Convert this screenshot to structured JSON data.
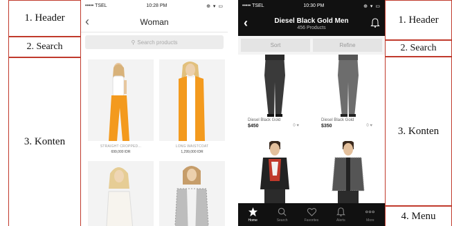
{
  "labels_left": [
    "1. Header",
    "2. Search",
    "3. Konten"
  ],
  "labels_right": [
    "1. Header",
    "2. Search",
    "3. Konten",
    "4. Menu"
  ],
  "phone1": {
    "status": {
      "carrier": "••••• TSEL",
      "time": "10:28 PM",
      "icons": "⊕ ▾ ▭"
    },
    "title": "Woman",
    "search_placeholder": "Search products",
    "products": [
      {
        "name": "STRAIGHT CROPPED...",
        "price": "699,000 IDR"
      },
      {
        "name": "LONG WAISTCOAT",
        "price": "1,299,000 IDR"
      },
      {
        "name": "",
        "price": ""
      },
      {
        "name": "",
        "price": ""
      }
    ]
  },
  "phone2": {
    "status": {
      "carrier": "••••• TSEL",
      "time": "10:30 PM",
      "icons": "⊕ ▾ ▭"
    },
    "title": "Diesel Black Gold Men",
    "subtitle": "456 Products",
    "sort_label": "Sort",
    "refine_label": "Refine",
    "products": [
      {
        "name": "Diesel Black Gold",
        "price": "$450",
        "wish": "0 ♥"
      },
      {
        "name": "Diesel Black Gold",
        "price": "$350",
        "wish": "0 ♥"
      },
      {
        "name": "",
        "price": "",
        "wish": ""
      },
      {
        "name": "",
        "price": "",
        "wish": ""
      }
    ],
    "tabs": [
      {
        "label": "Home",
        "icon": "star-icon"
      },
      {
        "label": "Search",
        "icon": "search-icon"
      },
      {
        "label": "Favorites",
        "icon": "heart-icon"
      },
      {
        "label": "Alerts",
        "icon": "bell-icon"
      },
      {
        "label": "More",
        "icon": "more-icon"
      }
    ]
  },
  "colors": {
    "annotation_border": "#c0392b",
    "dark_bar": "#111111",
    "orange_garment": "#f39a1e"
  }
}
